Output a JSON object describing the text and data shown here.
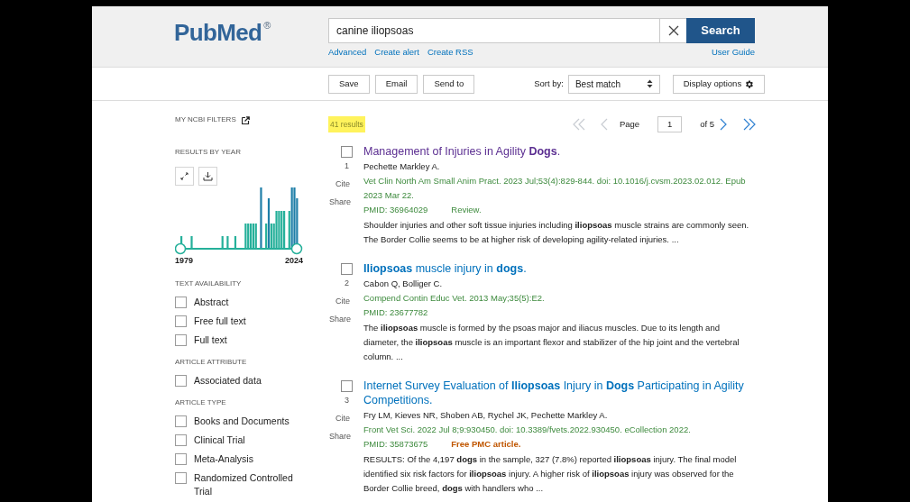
{
  "logo": {
    "text": "PubMed",
    "mark": "®"
  },
  "search": {
    "value": "canine iliopsoas",
    "button": "Search",
    "links": [
      "Advanced",
      "Create alert",
      "Create RSS"
    ],
    "user_guide": "User Guide"
  },
  "toolbar": {
    "buttons": [
      "Save",
      "Email",
      "Send to"
    ],
    "sort_label": "Sort by:",
    "sort_value": "Best match",
    "display_options": "Display options"
  },
  "sidebar": {
    "my_ncbi": "MY NCBI FILTERS",
    "results_by_year": {
      "title": "RESULTS BY YEAR",
      "start": "1979",
      "end": "2024"
    },
    "groups": [
      {
        "title": "TEXT AVAILABILITY",
        "items": [
          {
            "label": "Abstract",
            "checked": false
          },
          {
            "label": "Free full text",
            "checked": false
          },
          {
            "label": "Full text",
            "checked": false
          }
        ]
      },
      {
        "title": "ARTICLE ATTRIBUTE",
        "items": [
          {
            "label": "Associated data",
            "checked": false
          }
        ]
      },
      {
        "title": "ARTICLE TYPE",
        "items": [
          {
            "label": "Books and Documents",
            "checked": false
          },
          {
            "label": "Clinical Trial",
            "checked": false
          },
          {
            "label": "Meta-Analysis",
            "checked": false
          },
          {
            "label": "Randomized Controlled Trial",
            "checked": false
          }
        ]
      }
    ]
  },
  "results_count": "41 results",
  "pagination": {
    "label": "Page",
    "value": "1",
    "total": "of 5",
    "nav": [
      {
        "kind": "first",
        "disabled": true
      },
      {
        "kind": "prev",
        "disabled": true
      },
      {
        "kind": "next",
        "disabled": false
      },
      {
        "kind": "last",
        "disabled": false
      }
    ]
  },
  "results": [
    {
      "number": "1",
      "selected": false,
      "visited": true,
      "title": "Management of Injuries in Agility **Dogs**.",
      "authors": "Pechette Markley A.",
      "citation": "Vet Clin North Am Small Anim Pract. 2023 Jul;53(4):829-844. doi: 10.1016/j.cvsm.2023.02.012. Epub 2023 Mar 22.",
      "pmid": "PMID: 36964029",
      "tag": {
        "kind": "type",
        "text": "Review."
      },
      "snippet": "Shoulder injuries and other soft tissue injuries including **iliopsoas** muscle strains are commonly seen. The Border Collie seems to be at higher risk of developing agility-related injuries. ...",
      "actions": [
        "Cite",
        "Share"
      ]
    },
    {
      "number": "2",
      "selected": false,
      "visited": false,
      "title": "**Iliopsoas** muscle injury in **dogs**.",
      "authors": "Cabon Q, Bolliger C.",
      "citation": "Compend Contin Educ Vet. 2013 May;35(5):E2.",
      "pmid": "PMID: 23677782",
      "snippet": "The **iliopsoas** muscle is formed by the psoas major and iliacus muscles. Due to its length and diameter, the **iliopsoas** muscle is an important flexor and stabilizer of the hip joint and the vertebral column. ...",
      "actions": [
        "Cite",
        "Share"
      ]
    },
    {
      "number": "3",
      "selected": false,
      "visited": false,
      "title": "Internet Survey Evaluation of **Iliopsoas** Injury in **Dogs** Participating in Agility Competitions.",
      "authors": "Fry LM, Kieves NR, Shoben AB, Rychel JK, Pechette Markley A.",
      "citation": "Front Vet Sci. 2022 Jul 8;9:930450. doi: 10.3389/fvets.2022.930450. eCollection 2022.",
      "pmid": "PMID: 35873675",
      "tag": {
        "kind": "free",
        "text": "Free PMC article."
      },
      "snippet": "RESULTS: Of the 4,197 **dogs** in the sample, 327 (7.8%) reported **iliopsoas** injury. The final model identified six risk factors for **iliopsoas** injury. A higher risk of **iliopsoas** injury was observed for the Border Collie breed, **dogs** with handlers who ...",
      "actions": [
        "Cite",
        "Share"
      ]
    }
  ]
}
